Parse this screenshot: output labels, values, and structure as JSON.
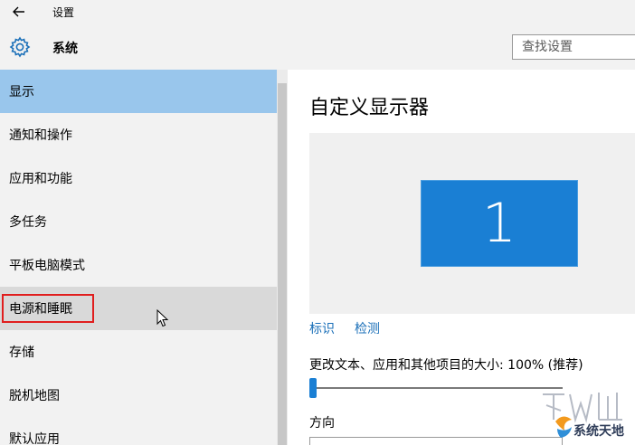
{
  "window": {
    "title": "设置",
    "back_icon": "back-arrow-icon"
  },
  "header": {
    "title": "系统",
    "icon": "gear-icon"
  },
  "search": {
    "placeholder": "查找设置"
  },
  "sidebar": {
    "items": [
      {
        "label": "显示",
        "state": "active"
      },
      {
        "label": "通知和操作"
      },
      {
        "label": "应用和功能"
      },
      {
        "label": "多任务"
      },
      {
        "label": "平板电脑模式"
      },
      {
        "label": "电源和睡眠",
        "state": "hover",
        "highlighted": true
      },
      {
        "label": "存储"
      },
      {
        "label": "脱机地图"
      },
      {
        "label": "默认应用"
      }
    ]
  },
  "main": {
    "title": "自定义显示器",
    "monitor_number": "1",
    "identify_link": "标识",
    "detect_link": "检测",
    "scale_label": "更改文本、应用和其他项目的大小: 100% (推荐)",
    "scale_value_percent": 100,
    "orientation_label": "方向"
  },
  "watermark": {
    "text": "系统天地"
  },
  "colors": {
    "accent": "#1a7fd4",
    "selected_bg": "#99c6ec",
    "hover_bg": "#d9d9d9",
    "highlight_border": "#e01e1e",
    "link": "#1a6fb8"
  }
}
